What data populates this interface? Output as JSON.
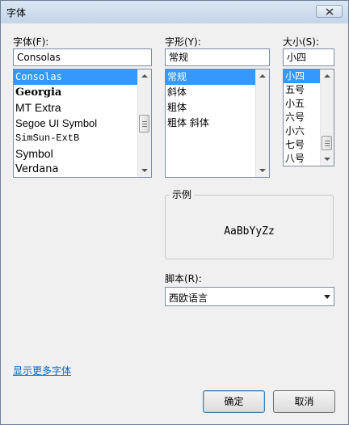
{
  "window": {
    "title": "字体"
  },
  "font": {
    "label": "字体(F):",
    "value": "Consolas",
    "items": [
      "Consolas",
      "Georgia",
      "MT Extra",
      "Segoe UI Symbol",
      "SimSun-ExtB",
      "Symbol",
      "Verdana"
    ]
  },
  "style": {
    "label": "字形(Y):",
    "value": "常规",
    "items": [
      "常规",
      "斜体",
      "粗体",
      "粗体 斜体"
    ]
  },
  "size": {
    "label": "大小(S):",
    "value": "小四",
    "items": [
      "小四",
      "五号",
      "小五",
      "六号",
      "小六",
      "七号",
      "八号"
    ]
  },
  "sample": {
    "legend": "示例",
    "text": "AaBbYyZz"
  },
  "script": {
    "label": "脚本(R):",
    "value": "西欧语言"
  },
  "more_fonts_link": "显示更多字体",
  "buttons": {
    "ok": "确定",
    "cancel": "取消"
  },
  "colors": {
    "selection": "#3399ff",
    "link": "#0066cc",
    "titlebar": "#c4d5ea"
  }
}
